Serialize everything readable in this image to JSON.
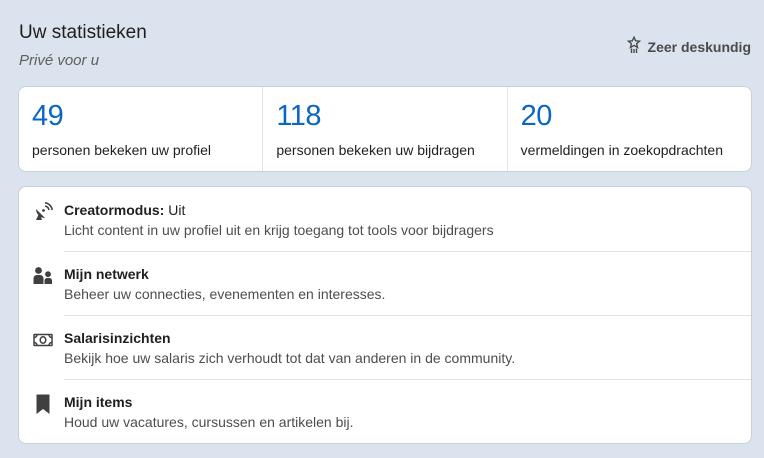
{
  "header": {
    "title": "Uw statistieken",
    "subtitle": "Privé voor u",
    "badge_label": "Zeer deskundig",
    "badge_icon": "star-medal-icon"
  },
  "stats": [
    {
      "value": "49",
      "label": "personen bekeken uw profiel"
    },
    {
      "value": "118",
      "label": "personen bekeken uw bijdragen"
    },
    {
      "value": "20",
      "label": "vermeldingen in zoekopdrachten"
    }
  ],
  "resources": [
    {
      "icon": "satellite-dish-icon",
      "title": "Creatormodus:",
      "value": " Uit",
      "desc": "Licht content in uw profiel uit en krijg toegang tot tools voor bijdragers"
    },
    {
      "icon": "people-icon",
      "title": "Mijn netwerk",
      "desc": "Beheer uw connecties, evenementen en interesses."
    },
    {
      "icon": "money-icon",
      "title": "Salarisinzichten",
      "desc": "Bekijk hoe uw salaris zich verhoudt tot dat van anderen in de community."
    },
    {
      "icon": "bookmark-icon",
      "title": "Mijn items",
      "desc": "Houd uw vacatures, cursussen en artikelen bij."
    }
  ],
  "colors": {
    "accent": "#0a66c2",
    "background": "#dbe3ee"
  }
}
